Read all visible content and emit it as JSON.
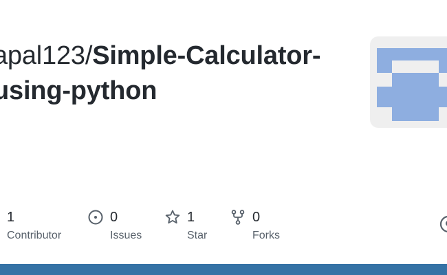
{
  "repo": {
    "owner": "apal123",
    "separator": "/",
    "name": "Simple-Calculator-using-python"
  },
  "stats": {
    "contributors": {
      "count": "1",
      "label": "Contributor",
      "icon": "people-icon"
    },
    "issues": {
      "count": "0",
      "label": "Issues",
      "icon": "issue-circle-icon"
    },
    "stars": {
      "count": "1",
      "label": "Star",
      "icon": "star-icon"
    },
    "forks": {
      "count": "0",
      "label": "Forks",
      "icon": "fork-icon"
    }
  },
  "colors": {
    "avatar_fill": "#8eaee0",
    "avatar_bg": "#efefef",
    "language_bar": "#3572a5",
    "title_text": "#24292f",
    "muted_text": "#57606a"
  }
}
